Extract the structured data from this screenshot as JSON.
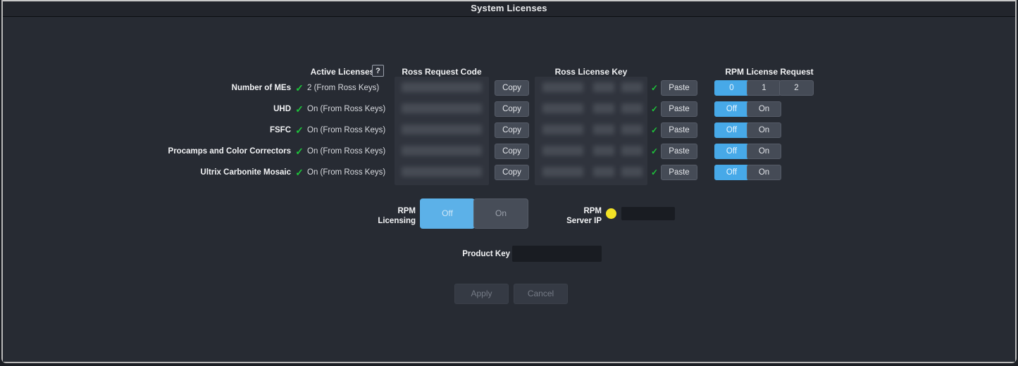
{
  "window": {
    "title": "System Licenses"
  },
  "grid": {
    "headers": {
      "active_licenses": "Active Licenses",
      "ross_request_code": "Ross Request Code",
      "ross_license_key": "Ross License Key",
      "rpm_license_request": "RPM License Request"
    },
    "help_label": "?",
    "copy_label": "Copy",
    "paste_label": "Paste",
    "check_glyph": "✓",
    "rows": [
      {
        "label": "Number of MEs",
        "status": "2 (From Ross Keys)",
        "request_code": "",
        "license_key": "",
        "rpm_options": [
          "0",
          "1",
          "2"
        ],
        "rpm_selected": "0"
      },
      {
        "label": "UHD",
        "status": "On (From Ross Keys)",
        "request_code": "",
        "license_key": "",
        "rpm_options": [
          "Off",
          "On"
        ],
        "rpm_selected": "Off"
      },
      {
        "label": "FSFC",
        "status": "On (From Ross Keys)",
        "request_code": "",
        "license_key": "",
        "rpm_options": [
          "Off",
          "On"
        ],
        "rpm_selected": "Off"
      },
      {
        "label": "Procamps and Color Correctors",
        "status": "On (From Ross Keys)",
        "request_code": "",
        "license_key": "",
        "rpm_options": [
          "Off",
          "On"
        ],
        "rpm_selected": "Off"
      },
      {
        "label": "Ultrix Carbonite Mosaic",
        "status": "On (From Ross Keys)",
        "request_code": "",
        "license_key": "",
        "rpm_options": [
          "Off",
          "On"
        ],
        "rpm_selected": "Off"
      }
    ]
  },
  "rpm_licensing": {
    "label_line1": "RPM",
    "label_line2": "Licensing",
    "off_label": "Off",
    "on_label": "On",
    "selected": "Off"
  },
  "rpm_server_ip": {
    "label_line1": "RPM",
    "label_line2": "Server IP",
    "led_color": "#f3e226",
    "value": "",
    "placeholder": ""
  },
  "product_key": {
    "label": "Product Key",
    "value": "",
    "placeholder": ""
  },
  "actions": {
    "apply_label": "Apply",
    "cancel_label": "Cancel"
  },
  "colors": {
    "accent_blue": "#47a9e8",
    "check_green": "#1dc43a",
    "led_yellow": "#f3e226",
    "background": "#272b33",
    "panel": "#30343d"
  }
}
